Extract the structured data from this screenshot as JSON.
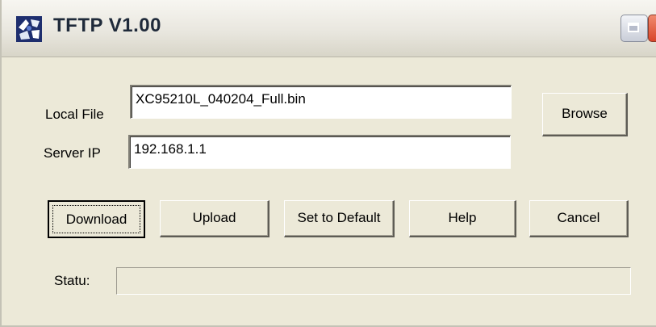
{
  "window": {
    "title": "TFTP V1.00"
  },
  "icons": {
    "app": "tftp-app-icon",
    "maximize": "restore-icon",
    "close": "close-icon"
  },
  "colors": {
    "window_bg": "#ece9d8",
    "close_btn": "#d8452a"
  },
  "form": {
    "local_file_label": "Local File",
    "local_file_value": "XC95210L_040204_Full.bin",
    "server_ip_label": "Server IP",
    "server_ip_value": "192.168.1.1"
  },
  "buttons": {
    "browse": "Browse",
    "download": "Download",
    "upload": "Upload",
    "set_default": "Set to Default",
    "help": "Help",
    "cancel": "Cancel"
  },
  "status": {
    "label": "Statu:",
    "value": ""
  }
}
